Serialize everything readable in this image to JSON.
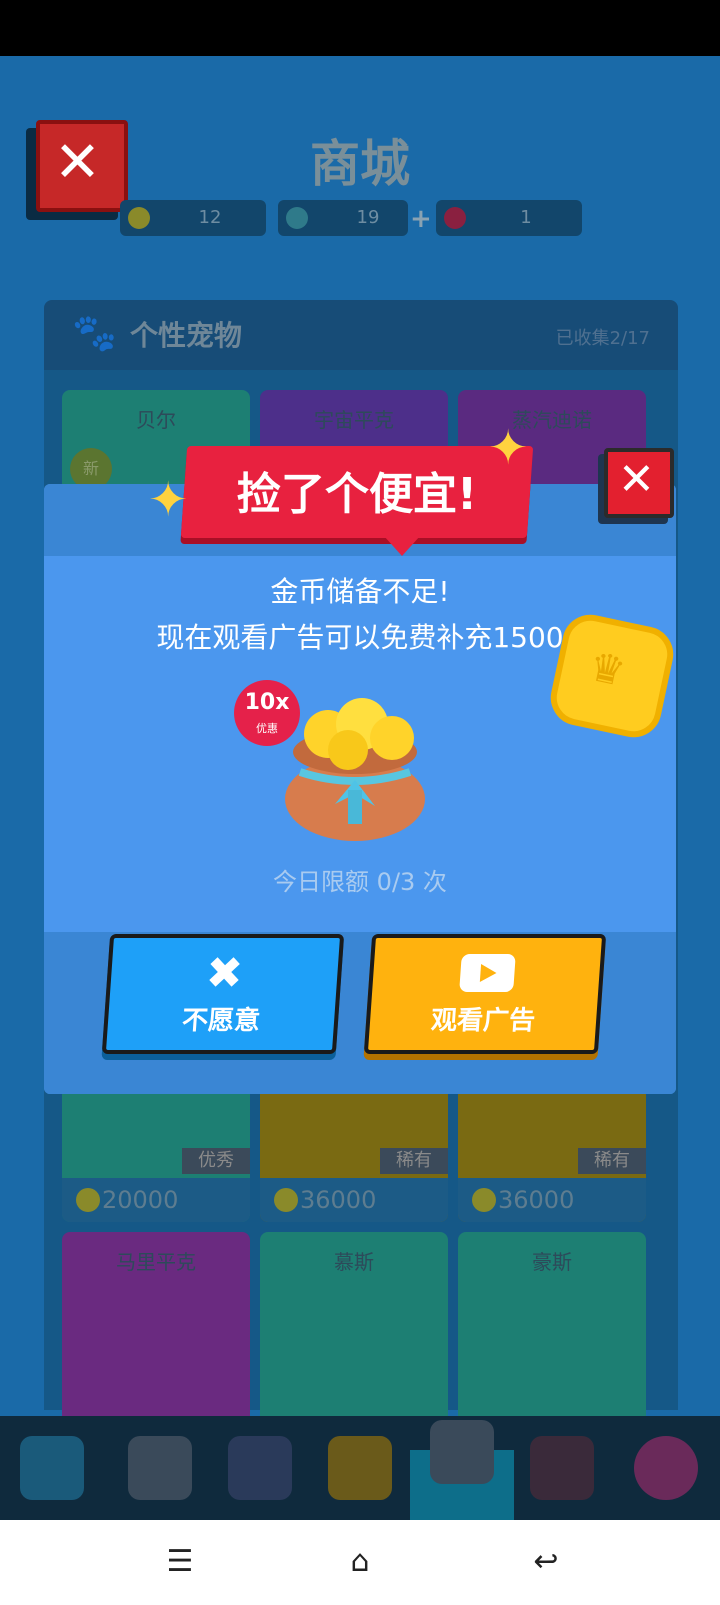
{
  "store": {
    "title": "商城",
    "coins": "12",
    "gems": "19",
    "tickets": "1",
    "section_title": "个性宠物",
    "collected": "已收集2/17",
    "new_badge": "新",
    "cards_row1": [
      {
        "name": "贝尔"
      },
      {
        "name": "宇宙平克"
      },
      {
        "name": "蒸汽迪诺"
      }
    ],
    "cards_row2": [
      {
        "price": "20000",
        "rarity": "优秀"
      },
      {
        "price": "36000",
        "rarity": "稀有"
      },
      {
        "price": "36000",
        "rarity": "稀有"
      }
    ],
    "cards_row3": [
      {
        "name": "马里平克"
      },
      {
        "name": "慕斯"
      },
      {
        "name": "豪斯"
      }
    ]
  },
  "modal": {
    "banner": "捡了个便宜!",
    "line1": "金币储备不足!",
    "line2": "现在观看广告可以免费补充1500",
    "badge_main": "10x",
    "badge_sub": "优惠",
    "limit": "今日限额 0/3 次",
    "btn_no": "不愿意",
    "btn_watch": "观看广告"
  },
  "colors": {
    "banner": "#e8213f",
    "btn_no": "#1ea0f8",
    "btn_watch": "#ffb20e",
    "modal_bg": "#4b97ee"
  }
}
